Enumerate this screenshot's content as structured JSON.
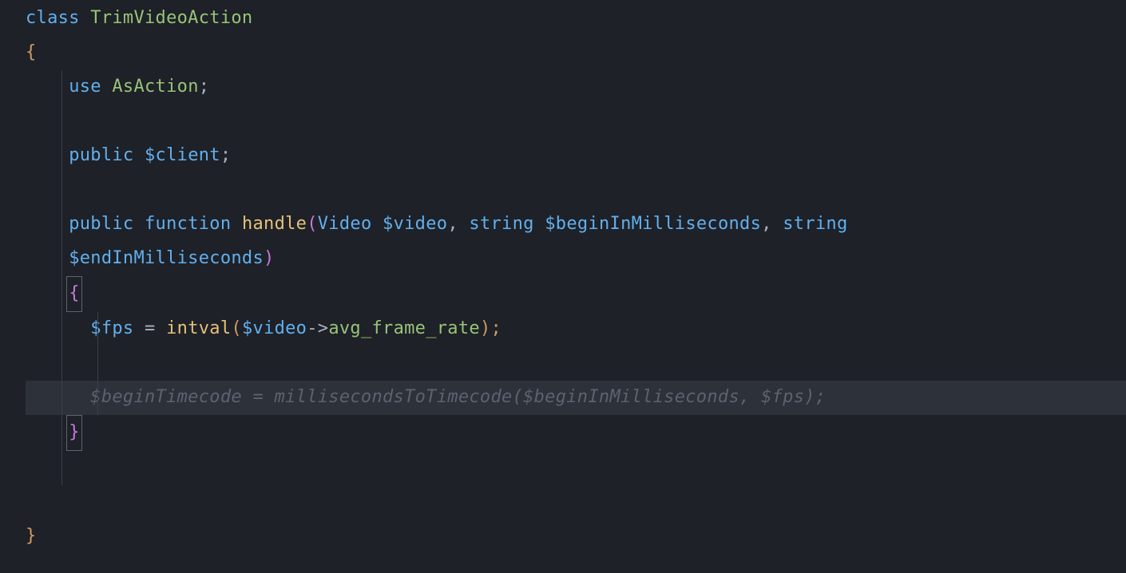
{
  "code": {
    "l1": {
      "kw": "class",
      "name": "TrimVideoAction"
    },
    "l2": {
      "brace": "{"
    },
    "l3": {
      "kw": "use",
      "name": "AsAction",
      "semi": ";"
    },
    "l5": {
      "kw": "public",
      "var": "$client",
      "semi": ";"
    },
    "l7": {
      "kw1": "public",
      "kw2": "function",
      "fn": "handle",
      "p1type": "Video",
      "p1": "$video",
      "p2type": "string",
      "p2": "$beginInMilliseconds",
      "p3type": "string"
    },
    "l8": {
      "p3": "$endInMilliseconds"
    },
    "l9": {
      "brace": "{"
    },
    "l10": {
      "var": "$fps",
      "eq": "=",
      "fn": "intval",
      "arg": "$video",
      "arrow": "->",
      "prop": "avg_frame_rate",
      "end": ");"
    },
    "l12": {
      "ghost": "$beginTimecode = millisecondsToTimecode($beginInMilliseconds, $fps);"
    },
    "l13": {
      "brace": "}"
    },
    "l16": {
      "brace": "}"
    }
  }
}
